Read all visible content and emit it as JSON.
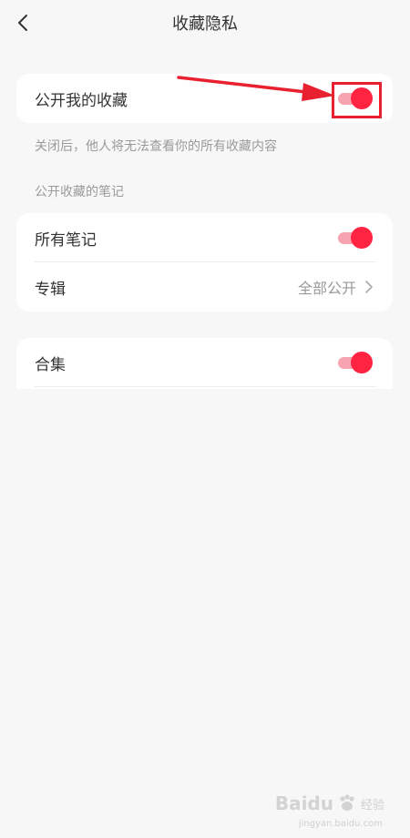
{
  "header": {
    "title": "收藏隐私"
  },
  "public_favorites": {
    "label": "公开我的收藏",
    "enabled": true,
    "hint": "关闭后，他人将无法查看你的所有收藏内容"
  },
  "section_title": "公开收藏的笔记",
  "notes_group": {
    "all_notes_label": "所有笔记",
    "all_notes_enabled": true,
    "album_label": "专辑",
    "album_value": "全部公开"
  },
  "collection_group": {
    "collection_label": "合集",
    "collection_enabled": true
  },
  "colors": {
    "accent": "#ff2442",
    "accent_light": "#f7a3b0",
    "annotation": "#e8202f",
    "background": "#f7f7f7"
  },
  "watermark": {
    "brand": "Baidu",
    "sub": "经验",
    "url": "jingyan.baidu.com"
  }
}
